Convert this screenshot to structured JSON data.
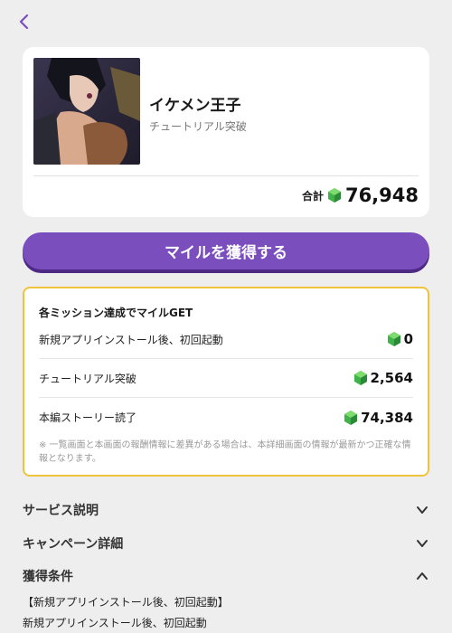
{
  "nav": {
    "back_icon": "chevron-left-icon"
  },
  "game": {
    "title": "イケメン王子",
    "subtitle": "チュートリアル突破"
  },
  "total": {
    "label": "合計",
    "value": "76,948",
    "icon": "green-gem-icon"
  },
  "cta": {
    "label": "マイルを獲得する"
  },
  "missions": {
    "heading": "各ミッション達成でマイルGET",
    "items": [
      {
        "label": "新規アプリインストール後、初回起動",
        "value": "0"
      },
      {
        "label": "チュートリアル突破",
        "value": "2,564"
      },
      {
        "label": "本編ストーリー読了",
        "value": "74,384"
      }
    ],
    "note": "※ 一覧画面と本画面の報酬情報に差異がある場合は、本詳細画面の情報が最新かつ正確な情報となります。"
  },
  "sections": [
    {
      "label": "サービス説明",
      "expanded": false
    },
    {
      "label": "キャンペーン詳細",
      "expanded": false
    },
    {
      "label": "獲得条件",
      "expanded": true
    }
  ],
  "conditions": {
    "line1": "【新規アプリインストール後、初回起動】",
    "line2": "新規アプリインストール後、初回起動"
  },
  "colors": {
    "accent": "#7a4ebd",
    "mission_border": "#f0c33a",
    "gem": "#3fb24a"
  }
}
